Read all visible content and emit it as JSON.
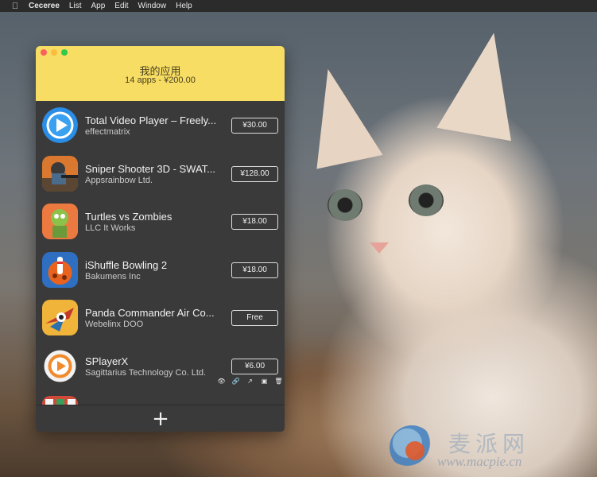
{
  "menubar": {
    "apple_icon": "apple-icon",
    "items": [
      "Ceceree",
      "List",
      "App",
      "Edit",
      "Window",
      "Help"
    ]
  },
  "window": {
    "title": "我的应用",
    "subtitle": "14 apps - ¥200.00",
    "header_color": "#f7dd63"
  },
  "apps": [
    {
      "name": "Total Video Player – Freely...",
      "developer": "effectmatrix",
      "price": "¥30.00",
      "icon": "play-circle-icon"
    },
    {
      "name": "Sniper Shooter 3D - SWAT...",
      "developer": "Appsrainbow Ltd.",
      "price": "¥128.00",
      "icon": "sniper-game-icon"
    },
    {
      "name": "Turtles vs Zombies",
      "developer": "LLC It Works",
      "price": "¥18.00",
      "icon": "zombie-game-icon"
    },
    {
      "name": "iShuffle Bowling 2",
      "developer": "Bakumens Inc",
      "price": "¥18.00",
      "icon": "bowling-game-icon"
    },
    {
      "name": "Panda Commander Air Co...",
      "developer": "Webelinx DOO",
      "price": "Free",
      "icon": "plane-game-icon"
    },
    {
      "name": "SPlayerX",
      "developer": "Sagittarius Technology Co. Ltd.",
      "price": "¥6.00",
      "icon": "splayer-icon"
    }
  ],
  "row_actions": [
    "eye-icon",
    "link-icon",
    "external-link-icon",
    "archive-icon",
    "trash-icon"
  ],
  "footer": {
    "add_label": "+"
  },
  "watermark": {
    "cn": "麦派网",
    "url": "www.macpie.cn"
  }
}
